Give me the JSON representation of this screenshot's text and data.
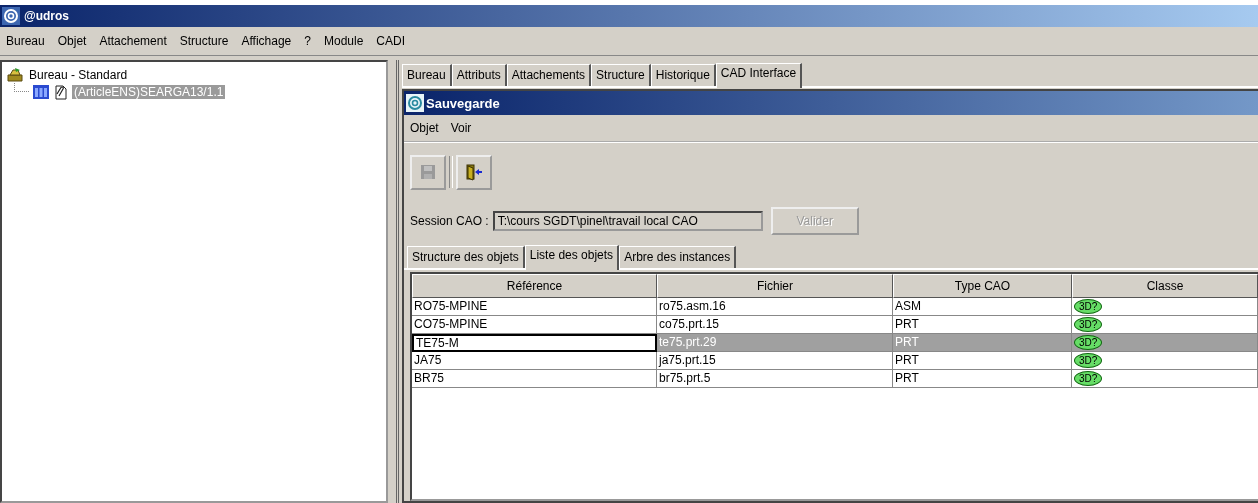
{
  "window": {
    "title": "@udros"
  },
  "menu": [
    "Bureau",
    "Objet",
    "Attachement",
    "Structure",
    "Affichage",
    "?",
    "Module",
    "CADI"
  ],
  "tree": {
    "label": "Bureau - Standard",
    "children": [
      {
        "label": "(ArticleENS)SEARGA13/1.1",
        "selected": true
      }
    ]
  },
  "tabs": [
    {
      "label": "Bureau",
      "selected": false
    },
    {
      "label": "Attributs",
      "selected": false
    },
    {
      "label": "Attachements",
      "selected": false
    },
    {
      "label": "Structure",
      "selected": false
    },
    {
      "label": "Historique",
      "selected": false
    },
    {
      "label": "CAD Interface",
      "selected": true
    }
  ],
  "dialog": {
    "title": "Sauvegarde",
    "menu": [
      "Objet",
      "Voir"
    ],
    "toolbar": [
      {
        "kind": "save",
        "disabled": true
      },
      {
        "kind": "exit",
        "disabled": false
      }
    ],
    "session": {
      "label": "Session CAO :",
      "value": "T:\\cours SGDT\\pinel\\travail local CAO",
      "button": "Valider",
      "button_disabled": true
    },
    "tabs": [
      {
        "label": "Structure des objets",
        "selected": false
      },
      {
        "label": "Liste des objets",
        "selected": true
      },
      {
        "label": "Arbre des instances",
        "selected": false
      }
    ],
    "table": {
      "columns": [
        "Référence",
        "Fichier",
        "Type CAO",
        "Classe"
      ],
      "rows": [
        {
          "reference": "RO75-MPINE",
          "fichier": "ro75.asm.16",
          "type": "ASM",
          "classe": "3D?",
          "selected": false,
          "editing": false
        },
        {
          "reference": "CO75-MPINE",
          "fichier": "co75.prt.15",
          "type": "PRT",
          "classe": "3D?",
          "selected": false,
          "editing": false
        },
        {
          "reference": "TE75-M",
          "fichier": "te75.prt.29",
          "type": "PRT",
          "classe": "3D?",
          "selected": true,
          "editing": true
        },
        {
          "reference": "JA75",
          "fichier": "ja75.prt.15",
          "type": "PRT",
          "classe": "3D?",
          "selected": false,
          "editing": false
        },
        {
          "reference": "BR75",
          "fichier": "br75.prt.5",
          "type": "PRT",
          "classe": "3D?",
          "selected": false,
          "editing": false
        }
      ]
    }
  }
}
